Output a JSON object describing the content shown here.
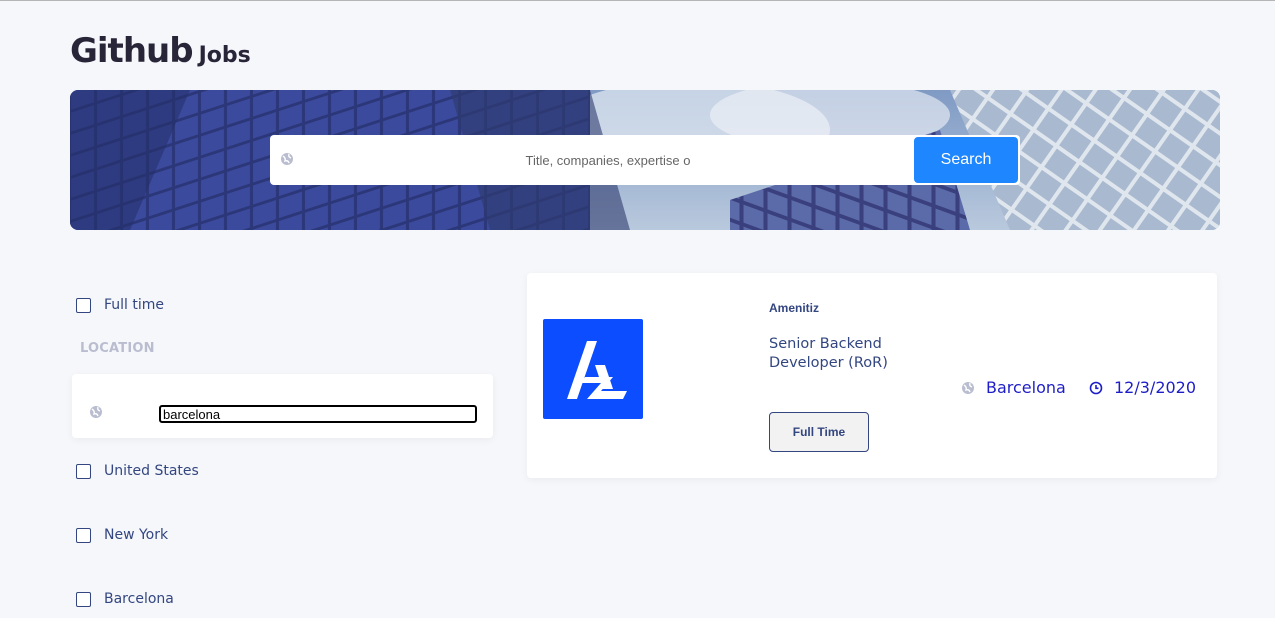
{
  "header": {
    "logo_main": "Github",
    "logo_sub": "Jobs"
  },
  "search": {
    "placeholder": "Title, companies, expertise o",
    "button_label": "Search",
    "icon": "globe-icon"
  },
  "filters": {
    "full_time_label": "Full time",
    "full_time_checked": false,
    "location_title": "LOCATION",
    "location_input_value": "barcelona",
    "location_icon": "globe-icon",
    "locations": [
      {
        "label": "United States",
        "checked": false
      },
      {
        "label": "New York",
        "checked": false
      },
      {
        "label": "Barcelona",
        "checked": false
      }
    ]
  },
  "jobs": [
    {
      "company": "Amenitiz",
      "title": "Senior Backend Developer (RoR)",
      "type": "Full Time",
      "location": "Barcelona",
      "date": "12/3/2020",
      "logo_color": "#0b4dff"
    }
  ],
  "colors": {
    "accent": "#1e86ff",
    "text": "#334680",
    "link": "#1e1ec8",
    "background": "#f6f7fb"
  }
}
